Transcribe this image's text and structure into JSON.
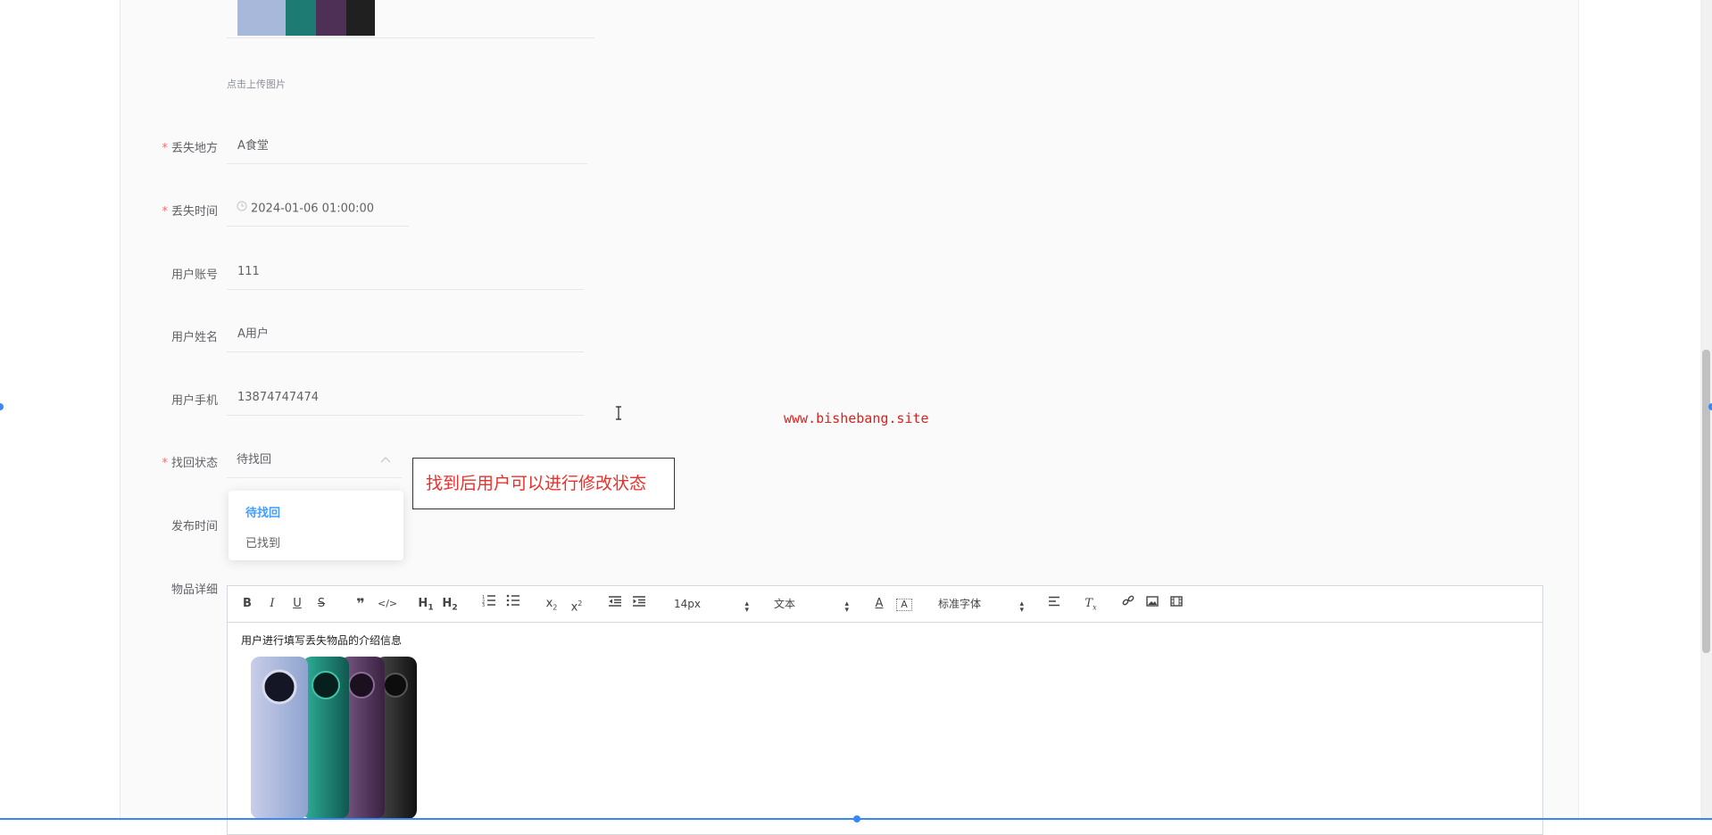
{
  "upload": {
    "hint": "点击上传图片"
  },
  "fields": {
    "lost_place": {
      "label": "丢失地方",
      "value": "A食堂"
    },
    "lost_time": {
      "label": "丢失时间",
      "value": "2024-01-06 01:00:00"
    },
    "user_account": {
      "label": "用户账号",
      "value": "111"
    },
    "user_name": {
      "label": "用户姓名",
      "value": "A用户"
    },
    "user_phone": {
      "label": "用户手机",
      "value": "13874747474"
    },
    "status": {
      "label": "找回状态",
      "value": "待找回"
    },
    "publish_time": {
      "label": "发布时间"
    },
    "detail": {
      "label": "物品详细"
    }
  },
  "status_options": [
    "待找回",
    "已找到"
  ],
  "callout": "找到后用户可以进行修改状态",
  "watermark": "www.bishebang.site",
  "editor": {
    "font_size": "14px",
    "block_format": "文本",
    "font_family": "标准字体",
    "content": "用户进行填写丢失物品的介绍信息"
  },
  "colors": {
    "required_star": "#f56c6c",
    "selected_option": "#409eff",
    "callout_text": "#e8312c",
    "watermark": "#d9231d"
  }
}
